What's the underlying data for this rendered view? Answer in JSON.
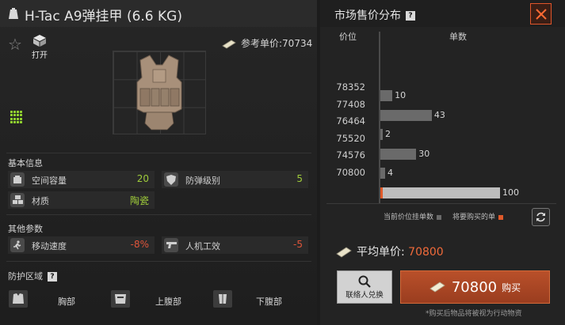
{
  "item": {
    "title": "H-Tac A9弹挂甲 (6.6 KG)",
    "open_label": "打开",
    "ref_price_label": "参考单价:",
    "ref_price_value": "70734"
  },
  "basic_info": {
    "title": "基本信息",
    "stats": [
      {
        "icon": "capacity-icon",
        "label": "空间容量",
        "value": "20",
        "color": "#9fcc3a"
      },
      {
        "icon": "armor-class-icon",
        "label": "防弹级别",
        "value": "5",
        "color": "#9fcc3a"
      },
      {
        "icon": "material-icon",
        "label": "材质",
        "value": "陶瓷",
        "color": "#9fcc3a"
      }
    ]
  },
  "other_params": {
    "title": "其他参数",
    "stats": [
      {
        "icon": "speed-icon",
        "label": "移动速度",
        "value": "-8%",
        "color": "#e0553a"
      },
      {
        "icon": "ergonomics-icon",
        "label": "人机工效",
        "value": "-5",
        "color": "#e0553a"
      }
    ]
  },
  "protection": {
    "title": "防护区域",
    "help": "?",
    "zones": [
      {
        "icon": "chest-icon",
        "label": "胸部"
      },
      {
        "icon": "upper-abdomen-icon",
        "label": "上腹部"
      },
      {
        "icon": "lower-abdomen-icon",
        "label": "下腹部"
      }
    ]
  },
  "market": {
    "title": "市场售价分布",
    "help": "?",
    "col_price": "价位",
    "col_qty": "单数",
    "legend_current": "当前价位挂单数",
    "legend_mine": "将要购买的单",
    "legend_current_color": "#6a6a6a",
    "legend_mine_color": "#e05a2a",
    "avg_label": "平均单价:",
    "avg_value": "70800",
    "contact_label": "联络人兑换",
    "buy_price": "70800",
    "buy_label": "购买",
    "footnote": "*购买后物品将被视为行动物资"
  },
  "chart_data": {
    "type": "bar",
    "orientation": "horizontal",
    "categories": [
      "78352",
      "77408",
      "76464",
      "75520",
      "74576",
      "70800"
    ],
    "values": [
      0,
      10,
      43,
      2,
      30,
      4,
      100
    ],
    "rows": [
      {
        "price": null,
        "count": 10
      },
      {
        "price": "77408",
        "count": 43
      },
      {
        "price": "76464",
        "count": 2
      },
      {
        "price": "75520",
        "count": 30
      },
      {
        "price": "74576",
        "count": 4
      },
      {
        "price": "70800",
        "count": 100
      }
    ],
    "price_labels": [
      "78352",
      "77408",
      "76464",
      "75520",
      "74576",
      "70800"
    ],
    "xlabel": "单数",
    "ylabel": "价位",
    "xlim": [
      0,
      100
    ],
    "highlight": {
      "price": "70800",
      "color": "#e05a2a"
    }
  }
}
